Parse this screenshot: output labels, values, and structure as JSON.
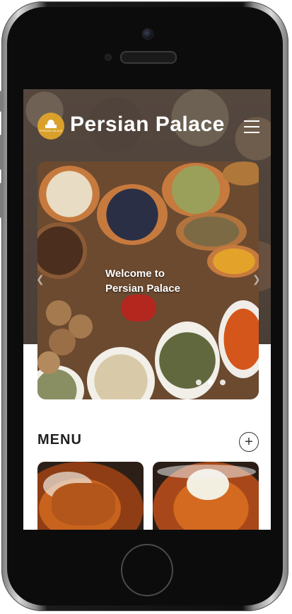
{
  "app": {
    "brand_name": "Persian Palace",
    "logo_text": "PERSIAN PALACE"
  },
  "hero": {
    "slide_caption_line1": "Welcome to",
    "slide_caption_line2": "Persian Palace",
    "slide_count": 4,
    "active_slide": 1
  },
  "menu": {
    "title": "MENU",
    "add_icon": "plus-circle-icon"
  },
  "colors": {
    "accent": "#d9a12b",
    "text_dark": "#222222",
    "header_text": "#ffffff"
  }
}
